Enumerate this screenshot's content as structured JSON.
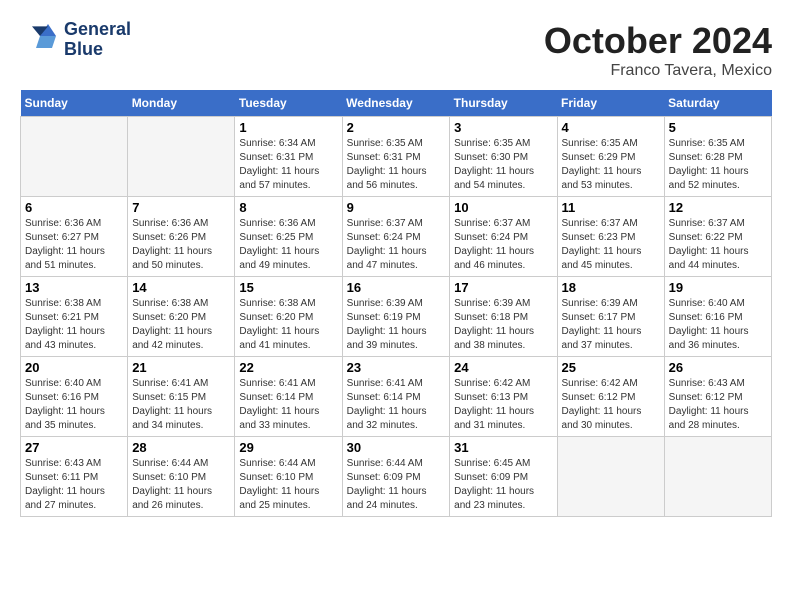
{
  "header": {
    "logo_line1": "General",
    "logo_line2": "Blue",
    "month": "October 2024",
    "location": "Franco Tavera, Mexico"
  },
  "weekdays": [
    "Sunday",
    "Monday",
    "Tuesday",
    "Wednesday",
    "Thursday",
    "Friday",
    "Saturday"
  ],
  "weeks": [
    [
      {
        "day": "",
        "sunrise": "",
        "sunset": "",
        "daylight": ""
      },
      {
        "day": "",
        "sunrise": "",
        "sunset": "",
        "daylight": ""
      },
      {
        "day": "1",
        "sunrise": "Sunrise: 6:34 AM",
        "sunset": "Sunset: 6:31 PM",
        "daylight": "Daylight: 11 hours and 57 minutes."
      },
      {
        "day": "2",
        "sunrise": "Sunrise: 6:35 AM",
        "sunset": "Sunset: 6:31 PM",
        "daylight": "Daylight: 11 hours and 56 minutes."
      },
      {
        "day": "3",
        "sunrise": "Sunrise: 6:35 AM",
        "sunset": "Sunset: 6:30 PM",
        "daylight": "Daylight: 11 hours and 54 minutes."
      },
      {
        "day": "4",
        "sunrise": "Sunrise: 6:35 AM",
        "sunset": "Sunset: 6:29 PM",
        "daylight": "Daylight: 11 hours and 53 minutes."
      },
      {
        "day": "5",
        "sunrise": "Sunrise: 6:35 AM",
        "sunset": "Sunset: 6:28 PM",
        "daylight": "Daylight: 11 hours and 52 minutes."
      }
    ],
    [
      {
        "day": "6",
        "sunrise": "Sunrise: 6:36 AM",
        "sunset": "Sunset: 6:27 PM",
        "daylight": "Daylight: 11 hours and 51 minutes."
      },
      {
        "day": "7",
        "sunrise": "Sunrise: 6:36 AM",
        "sunset": "Sunset: 6:26 PM",
        "daylight": "Daylight: 11 hours and 50 minutes."
      },
      {
        "day": "8",
        "sunrise": "Sunrise: 6:36 AM",
        "sunset": "Sunset: 6:25 PM",
        "daylight": "Daylight: 11 hours and 49 minutes."
      },
      {
        "day": "9",
        "sunrise": "Sunrise: 6:37 AM",
        "sunset": "Sunset: 6:24 PM",
        "daylight": "Daylight: 11 hours and 47 minutes."
      },
      {
        "day": "10",
        "sunrise": "Sunrise: 6:37 AM",
        "sunset": "Sunset: 6:24 PM",
        "daylight": "Daylight: 11 hours and 46 minutes."
      },
      {
        "day": "11",
        "sunrise": "Sunrise: 6:37 AM",
        "sunset": "Sunset: 6:23 PM",
        "daylight": "Daylight: 11 hours and 45 minutes."
      },
      {
        "day": "12",
        "sunrise": "Sunrise: 6:37 AM",
        "sunset": "Sunset: 6:22 PM",
        "daylight": "Daylight: 11 hours and 44 minutes."
      }
    ],
    [
      {
        "day": "13",
        "sunrise": "Sunrise: 6:38 AM",
        "sunset": "Sunset: 6:21 PM",
        "daylight": "Daylight: 11 hours and 43 minutes."
      },
      {
        "day": "14",
        "sunrise": "Sunrise: 6:38 AM",
        "sunset": "Sunset: 6:20 PM",
        "daylight": "Daylight: 11 hours and 42 minutes."
      },
      {
        "day": "15",
        "sunrise": "Sunrise: 6:38 AM",
        "sunset": "Sunset: 6:20 PM",
        "daylight": "Daylight: 11 hours and 41 minutes."
      },
      {
        "day": "16",
        "sunrise": "Sunrise: 6:39 AM",
        "sunset": "Sunset: 6:19 PM",
        "daylight": "Daylight: 11 hours and 39 minutes."
      },
      {
        "day": "17",
        "sunrise": "Sunrise: 6:39 AM",
        "sunset": "Sunset: 6:18 PM",
        "daylight": "Daylight: 11 hours and 38 minutes."
      },
      {
        "day": "18",
        "sunrise": "Sunrise: 6:39 AM",
        "sunset": "Sunset: 6:17 PM",
        "daylight": "Daylight: 11 hours and 37 minutes."
      },
      {
        "day": "19",
        "sunrise": "Sunrise: 6:40 AM",
        "sunset": "Sunset: 6:16 PM",
        "daylight": "Daylight: 11 hours and 36 minutes."
      }
    ],
    [
      {
        "day": "20",
        "sunrise": "Sunrise: 6:40 AM",
        "sunset": "Sunset: 6:16 PM",
        "daylight": "Daylight: 11 hours and 35 minutes."
      },
      {
        "day": "21",
        "sunrise": "Sunrise: 6:41 AM",
        "sunset": "Sunset: 6:15 PM",
        "daylight": "Daylight: 11 hours and 34 minutes."
      },
      {
        "day": "22",
        "sunrise": "Sunrise: 6:41 AM",
        "sunset": "Sunset: 6:14 PM",
        "daylight": "Daylight: 11 hours and 33 minutes."
      },
      {
        "day": "23",
        "sunrise": "Sunrise: 6:41 AM",
        "sunset": "Sunset: 6:14 PM",
        "daylight": "Daylight: 11 hours and 32 minutes."
      },
      {
        "day": "24",
        "sunrise": "Sunrise: 6:42 AM",
        "sunset": "Sunset: 6:13 PM",
        "daylight": "Daylight: 11 hours and 31 minutes."
      },
      {
        "day": "25",
        "sunrise": "Sunrise: 6:42 AM",
        "sunset": "Sunset: 6:12 PM",
        "daylight": "Daylight: 11 hours and 30 minutes."
      },
      {
        "day": "26",
        "sunrise": "Sunrise: 6:43 AM",
        "sunset": "Sunset: 6:12 PM",
        "daylight": "Daylight: 11 hours and 28 minutes."
      }
    ],
    [
      {
        "day": "27",
        "sunrise": "Sunrise: 6:43 AM",
        "sunset": "Sunset: 6:11 PM",
        "daylight": "Daylight: 11 hours and 27 minutes."
      },
      {
        "day": "28",
        "sunrise": "Sunrise: 6:44 AM",
        "sunset": "Sunset: 6:10 PM",
        "daylight": "Daylight: 11 hours and 26 minutes."
      },
      {
        "day": "29",
        "sunrise": "Sunrise: 6:44 AM",
        "sunset": "Sunset: 6:10 PM",
        "daylight": "Daylight: 11 hours and 25 minutes."
      },
      {
        "day": "30",
        "sunrise": "Sunrise: 6:44 AM",
        "sunset": "Sunset: 6:09 PM",
        "daylight": "Daylight: 11 hours and 24 minutes."
      },
      {
        "day": "31",
        "sunrise": "Sunrise: 6:45 AM",
        "sunset": "Sunset: 6:09 PM",
        "daylight": "Daylight: 11 hours and 23 minutes."
      },
      {
        "day": "",
        "sunrise": "",
        "sunset": "",
        "daylight": ""
      },
      {
        "day": "",
        "sunrise": "",
        "sunset": "",
        "daylight": ""
      }
    ]
  ]
}
